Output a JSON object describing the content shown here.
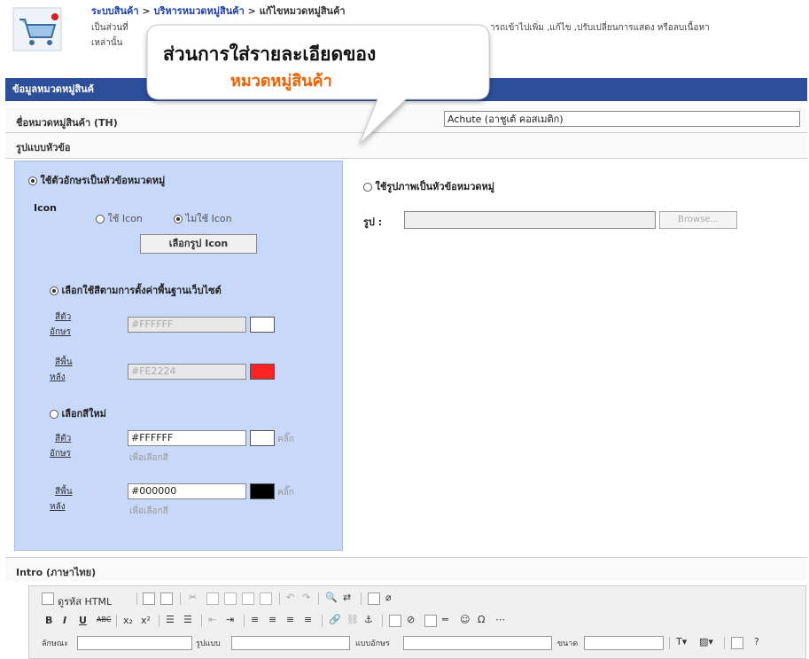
{
  "header": {
    "breadcrumb": [
      "ระบบสินค้า",
      "บริหารหมวดหมู่สินค้า",
      "แก้ไขหมวดหมู่สินค้า"
    ],
    "breadcrumb_sep": ">",
    "desc_line1_a": "เป็นส่วนที่",
    "desc_line1_b": "ารถเข้าไปเพิ่ม ,แก้ไข ,ปรับเปลี่ยนการแสดง หรือลบเนื้อหา",
    "desc_line2": "เหล่านั้น"
  },
  "callout": {
    "line1": "ส่วนการใส่รายละเอียดของ",
    "line2": "หมวดหมู่สินค้า"
  },
  "section_bar": "ข้อมูลหมวดหมู่สินค้",
  "name_row": {
    "label": "ชื่อหมวดหมู่สินค้า (TH)",
    "value": "Achute (อาชูเต้ คอสเมติก)"
  },
  "format_row": {
    "label": "รูปแบบหัวข้อ"
  },
  "left_panel": {
    "text_option": "ใช้ตัวอักษรเป็นหัวข้อหมวดหมู่",
    "icon_label": "Icon",
    "use_icon": "ใช้ Icon",
    "no_icon": "ไม่ใช้ Icon",
    "choose_icon_btn": "เลือกรูป Icon",
    "default_color_option": "เลือกใช้สีตามการตั้งค่าพื้นฐานเว็บไซต์",
    "text_color_label_1": "สีตัว",
    "text_color_label_2": "อักษร",
    "bg_color_label_1": "สีพื้น",
    "bg_color_label_2": "หลัง",
    "default_text_color": "#FFFFFF",
    "default_bg_color": "#FE2224",
    "new_color_option": "เลือกสีใหม่",
    "new_text_color": "#FFFFFF",
    "new_bg_color": "#000000",
    "click_hint_1": "คลิ๊ก",
    "click_hint_2": "เพื่อเลือกสี"
  },
  "right_panel": {
    "image_option": "ใช้รูปภาพเป็นหัวข้อหมวดหมู่",
    "image_label": "รูป :",
    "browse_btn": "Browse..."
  },
  "intro": {
    "label": "Intro (ภาษาไทย)"
  },
  "toolbar": {
    "source_btn": "ดูรหัส HTML",
    "font_label": "ลักษณะ",
    "format_label": "รูปแบบ",
    "style_label": "แบบอักษร",
    "size_label": "ขนาด"
  },
  "colors": {
    "header_bar": "#2d4f9a",
    "left_panel": "#c8d8f8",
    "accent_orange": "#f06000",
    "link_blue": "#1a3fb0"
  }
}
